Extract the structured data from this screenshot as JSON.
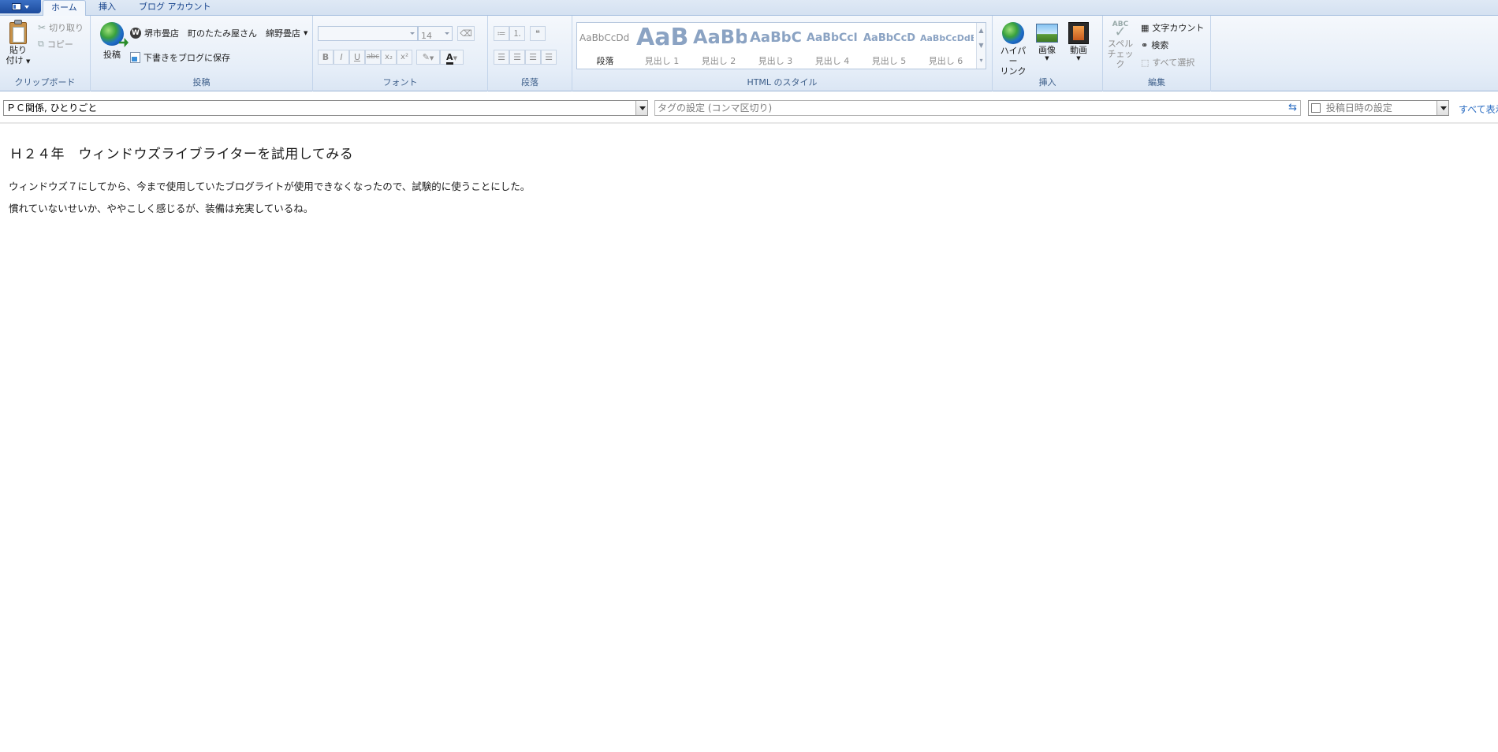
{
  "tabs": [
    {
      "label": "ホーム",
      "active": true
    },
    {
      "label": "挿入",
      "active": false
    },
    {
      "label": "ブログ アカウント",
      "active": false
    }
  ],
  "clipboard": {
    "paste_label_line1": "貼り",
    "paste_label_line2": "付け",
    "cut_label": "切り取り",
    "copy_label": "コピー",
    "group_label": "クリップボード"
  },
  "publish": {
    "publish_label": "投稿",
    "blog_name": "堺市畳店　町のたたみ屋さん　綿野畳店",
    "save_draft_label": "下書きをブログに保存",
    "group_label": "投稿"
  },
  "font": {
    "font_name": "",
    "font_size": "14",
    "group_label": "フォント",
    "bold": "B",
    "italic": "I",
    "underline": "U",
    "strike": "abc",
    "subscript": "x₂",
    "superscript": "x²",
    "font_color_letter": "A"
  },
  "paragraph": {
    "group_label": "段落"
  },
  "styles": {
    "group_label": "HTML のスタイル",
    "items": [
      {
        "sample": "AaBbCcDd",
        "name": "段落"
      },
      {
        "sample": "AaB",
        "name": "見出し 1"
      },
      {
        "sample": "AaBb",
        "name": "見出し 2"
      },
      {
        "sample": "AaBbC",
        "name": "見出し 3"
      },
      {
        "sample": "AaBbCcI",
        "name": "見出し 4"
      },
      {
        "sample": "AaBbCcD",
        "name": "見出し 5"
      },
      {
        "sample": "AaBbCcDdE",
        "name": "見出し 6"
      }
    ]
  },
  "insert": {
    "hyperlink_line1": "ハイパー",
    "hyperlink_line2": "リンク",
    "image_label": "画像",
    "video_label": "動画",
    "group_label": "挿入"
  },
  "edit": {
    "spell_line1": "スペル",
    "spell_line2": "チェック",
    "spell_icon_text": "ABC",
    "word_count_label": "文字カウント",
    "find_label": "検索",
    "select_all_label": "すべて選択",
    "group_label": "編集"
  },
  "metabar": {
    "category_value": "ＰＣ関係, ひとりごと",
    "tags_placeholder": "タグの設定 (コンマ区切り)",
    "post_date_label": "投稿日時の設定",
    "show_all_label": "すべて表示"
  },
  "document": {
    "title": "Ｈ２４年　ウィンドウズライブライターを試用してみる",
    "paragraphs": [
      "ウィンドウズ７にしてから、今まで使用していたブログライトが使用できなくなったので、試験的に使うことにした。",
      "慣れていないせいか、ややこしく感じるが、装備は充実しているね。"
    ]
  }
}
